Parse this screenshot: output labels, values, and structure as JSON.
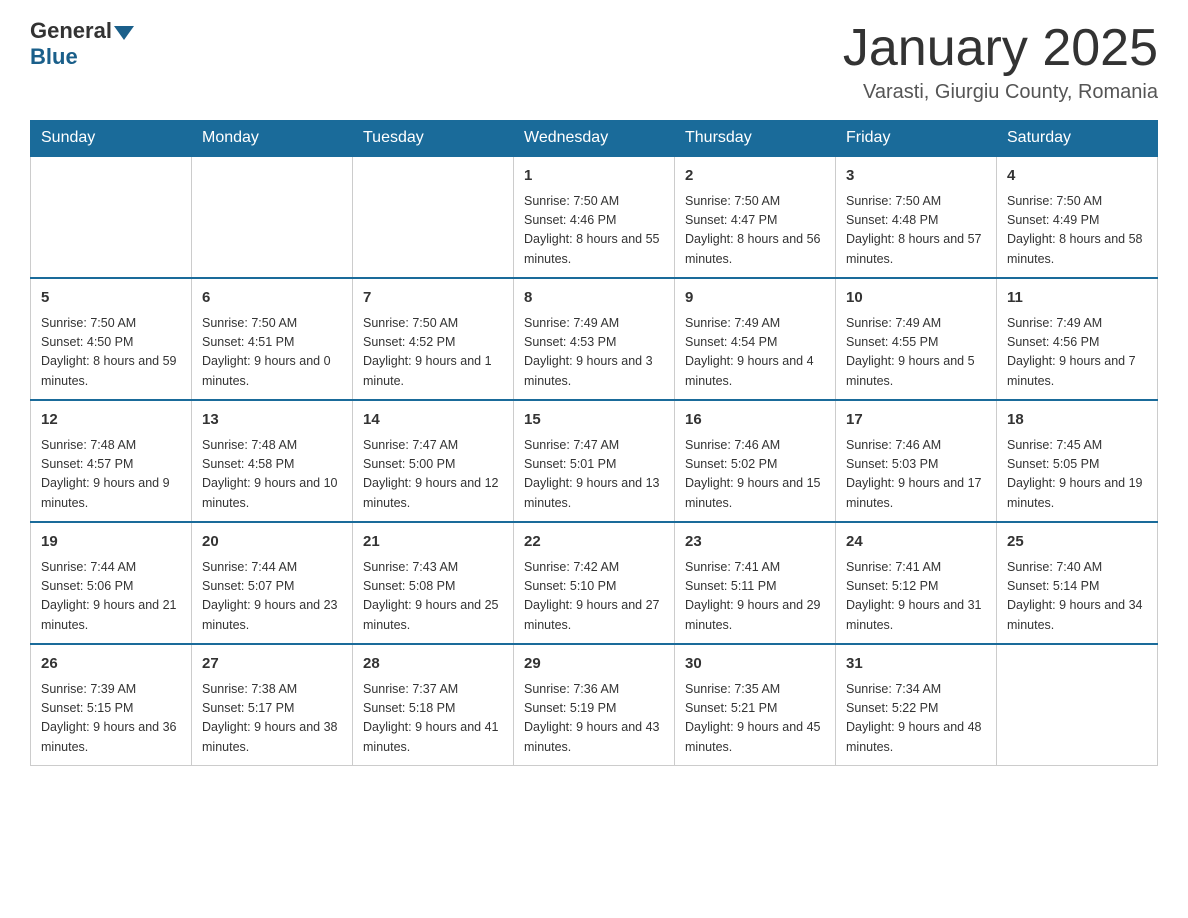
{
  "header": {
    "logo_general": "General",
    "logo_blue": "Blue",
    "month_title": "January 2025",
    "location": "Varasti, Giurgiu County, Romania"
  },
  "days_of_week": [
    "Sunday",
    "Monday",
    "Tuesday",
    "Wednesday",
    "Thursday",
    "Friday",
    "Saturday"
  ],
  "weeks": [
    [
      {
        "num": "",
        "info": ""
      },
      {
        "num": "",
        "info": ""
      },
      {
        "num": "",
        "info": ""
      },
      {
        "num": "1",
        "info": "Sunrise: 7:50 AM\nSunset: 4:46 PM\nDaylight: 8 hours\nand 55 minutes."
      },
      {
        "num": "2",
        "info": "Sunrise: 7:50 AM\nSunset: 4:47 PM\nDaylight: 8 hours\nand 56 minutes."
      },
      {
        "num": "3",
        "info": "Sunrise: 7:50 AM\nSunset: 4:48 PM\nDaylight: 8 hours\nand 57 minutes."
      },
      {
        "num": "4",
        "info": "Sunrise: 7:50 AM\nSunset: 4:49 PM\nDaylight: 8 hours\nand 58 minutes."
      }
    ],
    [
      {
        "num": "5",
        "info": "Sunrise: 7:50 AM\nSunset: 4:50 PM\nDaylight: 8 hours\nand 59 minutes."
      },
      {
        "num": "6",
        "info": "Sunrise: 7:50 AM\nSunset: 4:51 PM\nDaylight: 9 hours\nand 0 minutes."
      },
      {
        "num": "7",
        "info": "Sunrise: 7:50 AM\nSunset: 4:52 PM\nDaylight: 9 hours\nand 1 minute."
      },
      {
        "num": "8",
        "info": "Sunrise: 7:49 AM\nSunset: 4:53 PM\nDaylight: 9 hours\nand 3 minutes."
      },
      {
        "num": "9",
        "info": "Sunrise: 7:49 AM\nSunset: 4:54 PM\nDaylight: 9 hours\nand 4 minutes."
      },
      {
        "num": "10",
        "info": "Sunrise: 7:49 AM\nSunset: 4:55 PM\nDaylight: 9 hours\nand 5 minutes."
      },
      {
        "num": "11",
        "info": "Sunrise: 7:49 AM\nSunset: 4:56 PM\nDaylight: 9 hours\nand 7 minutes."
      }
    ],
    [
      {
        "num": "12",
        "info": "Sunrise: 7:48 AM\nSunset: 4:57 PM\nDaylight: 9 hours\nand 9 minutes."
      },
      {
        "num": "13",
        "info": "Sunrise: 7:48 AM\nSunset: 4:58 PM\nDaylight: 9 hours\nand 10 minutes."
      },
      {
        "num": "14",
        "info": "Sunrise: 7:47 AM\nSunset: 5:00 PM\nDaylight: 9 hours\nand 12 minutes."
      },
      {
        "num": "15",
        "info": "Sunrise: 7:47 AM\nSunset: 5:01 PM\nDaylight: 9 hours\nand 13 minutes."
      },
      {
        "num": "16",
        "info": "Sunrise: 7:46 AM\nSunset: 5:02 PM\nDaylight: 9 hours\nand 15 minutes."
      },
      {
        "num": "17",
        "info": "Sunrise: 7:46 AM\nSunset: 5:03 PM\nDaylight: 9 hours\nand 17 minutes."
      },
      {
        "num": "18",
        "info": "Sunrise: 7:45 AM\nSunset: 5:05 PM\nDaylight: 9 hours\nand 19 minutes."
      }
    ],
    [
      {
        "num": "19",
        "info": "Sunrise: 7:44 AM\nSunset: 5:06 PM\nDaylight: 9 hours\nand 21 minutes."
      },
      {
        "num": "20",
        "info": "Sunrise: 7:44 AM\nSunset: 5:07 PM\nDaylight: 9 hours\nand 23 minutes."
      },
      {
        "num": "21",
        "info": "Sunrise: 7:43 AM\nSunset: 5:08 PM\nDaylight: 9 hours\nand 25 minutes."
      },
      {
        "num": "22",
        "info": "Sunrise: 7:42 AM\nSunset: 5:10 PM\nDaylight: 9 hours\nand 27 minutes."
      },
      {
        "num": "23",
        "info": "Sunrise: 7:41 AM\nSunset: 5:11 PM\nDaylight: 9 hours\nand 29 minutes."
      },
      {
        "num": "24",
        "info": "Sunrise: 7:41 AM\nSunset: 5:12 PM\nDaylight: 9 hours\nand 31 minutes."
      },
      {
        "num": "25",
        "info": "Sunrise: 7:40 AM\nSunset: 5:14 PM\nDaylight: 9 hours\nand 34 minutes."
      }
    ],
    [
      {
        "num": "26",
        "info": "Sunrise: 7:39 AM\nSunset: 5:15 PM\nDaylight: 9 hours\nand 36 minutes."
      },
      {
        "num": "27",
        "info": "Sunrise: 7:38 AM\nSunset: 5:17 PM\nDaylight: 9 hours\nand 38 minutes."
      },
      {
        "num": "28",
        "info": "Sunrise: 7:37 AM\nSunset: 5:18 PM\nDaylight: 9 hours\nand 41 minutes."
      },
      {
        "num": "29",
        "info": "Sunrise: 7:36 AM\nSunset: 5:19 PM\nDaylight: 9 hours\nand 43 minutes."
      },
      {
        "num": "30",
        "info": "Sunrise: 7:35 AM\nSunset: 5:21 PM\nDaylight: 9 hours\nand 45 minutes."
      },
      {
        "num": "31",
        "info": "Sunrise: 7:34 AM\nSunset: 5:22 PM\nDaylight: 9 hours\nand 48 minutes."
      },
      {
        "num": "",
        "info": ""
      }
    ]
  ]
}
